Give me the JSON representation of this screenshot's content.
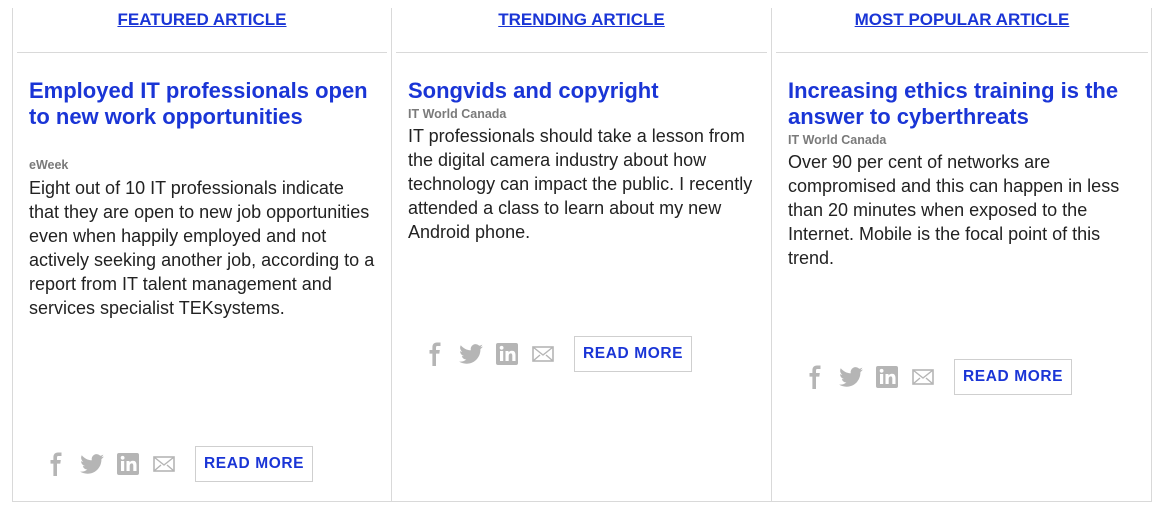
{
  "colors": {
    "link": "#1a35d6",
    "source": "#7a7a7a",
    "text": "#222222",
    "icon": "#b5b5b5",
    "border": "#d9d9d9"
  },
  "columns": [
    {
      "heading": "FEATURED ARTICLE",
      "title": "Employed IT professionals open to new work opportunities",
      "source": "eWeek",
      "summary": "Eight out of 10 IT professionals indicate that they are open to new job opportunities even when happily employed and not actively seeking another job, according to a report from IT talent management and services specialist TEKsystems.",
      "share_icons": [
        "facebook-icon",
        "twitter-icon",
        "linkedin-icon",
        "email-icon"
      ],
      "read_more": "READ MORE"
    },
    {
      "heading": "TRENDING ARTICLE",
      "title": "Songvids and copyright",
      "source": "IT World Canada",
      "summary": "IT professionals should take a lesson from the digital camera industry about how technology can impact the public. I recently attended a class to learn about my new Android phone.",
      "share_icons": [
        "facebook-icon",
        "twitter-icon",
        "linkedin-icon",
        "email-icon"
      ],
      "read_more": "READ MORE"
    },
    {
      "heading": "MOST POPULAR ARTICLE",
      "title": "Increasing ethics training is the answer to cyberthreats",
      "source": "IT World Canada",
      "summary": "Over 90 per cent of networks are compromised and this can happen in less than 20 minutes when exposed to the Internet. Mobile is the focal point of this trend.",
      "share_icons": [
        "facebook-icon",
        "twitter-icon",
        "linkedin-icon",
        "email-icon"
      ],
      "read_more": "READ MORE"
    }
  ]
}
